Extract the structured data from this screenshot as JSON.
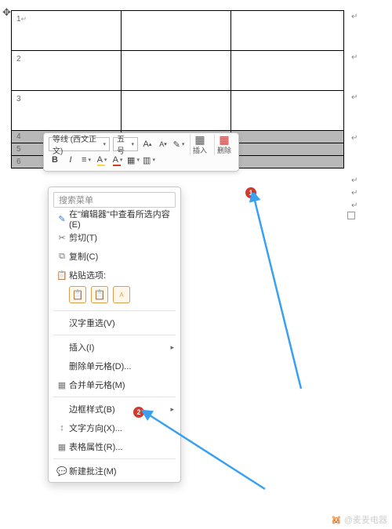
{
  "table": {
    "rows": [
      "1",
      "2",
      "3",
      "4",
      "5",
      "6"
    ],
    "para_mark": "↵"
  },
  "mini_toolbar": {
    "font_name": "等线 (西文正文)",
    "font_size": "五号",
    "grow": "A",
    "shrink": "A",
    "format_painter": "✎",
    "bold": "B",
    "italic": "I",
    "underline": "≡",
    "font_color": "A",
    "highlight": "A",
    "border": "▦",
    "insert_label": "插入",
    "delete_label": "删除"
  },
  "context_menu": {
    "search_placeholder": "搜索菜单",
    "editor_view": "在\"编辑器\"中查看所选内容(E)",
    "cut": "剪切(T)",
    "copy": "复制(C)",
    "paste_options": "粘贴选项:",
    "chinese_reselect": "汉字重选(V)",
    "insert": "插入(I)",
    "delete_cells": "删除单元格(D)...",
    "merge_cells": "合并单元格(M)",
    "border_style": "边框样式(B)",
    "text_direction": "文字方向(X)...",
    "table_properties": "表格属性(R)...",
    "new_comment": "新建批注(M)"
  },
  "badges": {
    "b1": "1",
    "b2": "2"
  },
  "watermark": "@麦麦电器"
}
